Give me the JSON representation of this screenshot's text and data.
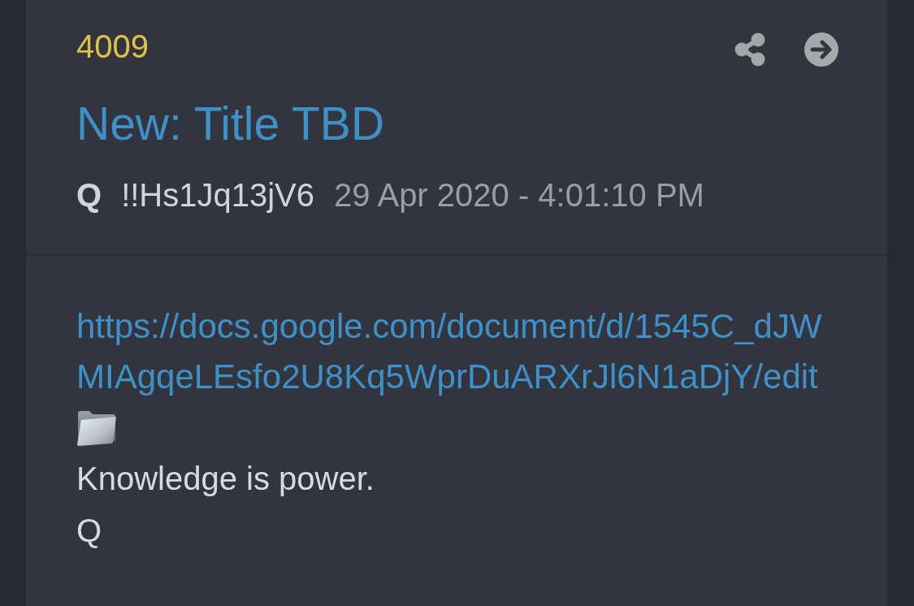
{
  "post": {
    "number": "4009",
    "title": "New: Title TBD",
    "author": "Q",
    "tripcode": "!!Hs1Jq13jV6",
    "timestamp": "29 Apr 2020 - 4:01:10 PM"
  },
  "body": {
    "link": "https://docs.google.com/document/d/1545C_dJWMIAgqeLEsfo2U8Kq5WprDuARXrJl6N1aDjY/edit",
    "lines": [
      "Knowledge is power.",
      "Q"
    ]
  }
}
